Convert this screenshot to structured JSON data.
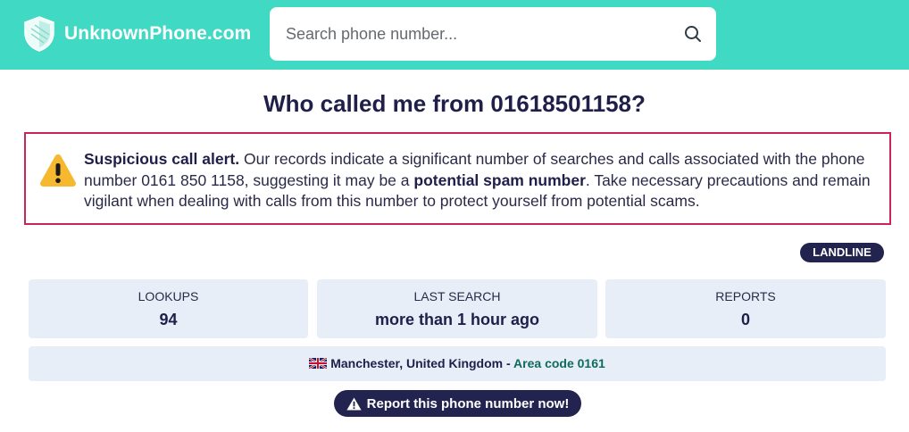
{
  "header": {
    "logo_text": "UnknownPhone.com",
    "search_placeholder": "Search phone number..."
  },
  "page": {
    "title": "Who called me from 01618501158?"
  },
  "alert": {
    "heading": "Suspicious call alert.",
    "text_part1": " Our records indicate a significant number of searches and calls associated with the phone number 0161 850 1158, suggesting it may be a ",
    "emphasis": "potential spam number",
    "text_part2": ". Take necessary precautions and remain vigilant when dealing with calls from this number to protect yourself from potential scams."
  },
  "badge": "LANDLINE",
  "stats": [
    {
      "label": "LOOKUPS",
      "value": "94"
    },
    {
      "label": "LAST SEARCH",
      "value": "more than 1 hour ago"
    },
    {
      "label": "REPORTS",
      "value": "0"
    }
  ],
  "location": {
    "flag_icon": "uk-flag-icon",
    "place": "Manchester, United Kingdom",
    "separator": " - ",
    "area_code": "Area code 0161"
  },
  "report_button": {
    "icon": "warning-icon",
    "label": "Report this phone number now!"
  },
  "colors": {
    "header_bg": "#3fd9c4",
    "navy": "#23234f",
    "alert_border": "#c8245a",
    "card_bg": "#e7eef8",
    "warning_yellow": "#f5b82e"
  }
}
